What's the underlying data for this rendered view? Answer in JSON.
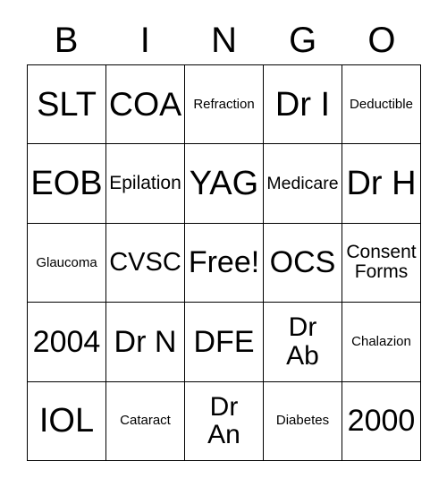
{
  "card": {
    "title": "BINGO",
    "header_letters": [
      "B",
      "I",
      "N",
      "G",
      "O"
    ],
    "grid_colors": {
      "border": "#000000",
      "background": "#ffffff",
      "text": "#000000"
    },
    "rows": [
      [
        {
          "text": "SLT",
          "size": "xl"
        },
        {
          "text": "COA",
          "size": "xl"
        },
        {
          "text": "Refraction",
          "size": "xs"
        },
        {
          "text": "Dr I",
          "size": "xl"
        },
        {
          "text": "Deductible",
          "size": "xs"
        }
      ],
      [
        {
          "text": "EOB",
          "size": "xl"
        },
        {
          "text": "Epilation",
          "size": "sm"
        },
        {
          "text": "YAG",
          "size": "xl"
        },
        {
          "text": "Medicare",
          "size": "sm"
        },
        {
          "text": "Dr H",
          "size": "xl"
        }
      ],
      [
        {
          "text": "Glaucoma",
          "size": "xs"
        },
        {
          "text": "CVSC",
          "size": "lg"
        },
        {
          "text": "Free!",
          "size": "lg"
        },
        {
          "text": "OCS",
          "size": "lg"
        },
        {
          "text": "Consent\nForms",
          "size": "sm"
        }
      ],
      [
        {
          "text": "2004",
          "size": "lg"
        },
        {
          "text": "Dr N",
          "size": "lg"
        },
        {
          "text": "DFE",
          "size": "lg"
        },
        {
          "text": "Dr\nAb",
          "size": "md"
        },
        {
          "text": "Chalazion",
          "size": "xs"
        }
      ],
      [
        {
          "text": "IOL",
          "size": "xl"
        },
        {
          "text": "Cataract",
          "size": "xs"
        },
        {
          "text": "Dr\nAn",
          "size": "md"
        },
        {
          "text": "Diabetes",
          "size": "xs"
        },
        {
          "text": "2000",
          "size": "lg"
        }
      ]
    ]
  }
}
